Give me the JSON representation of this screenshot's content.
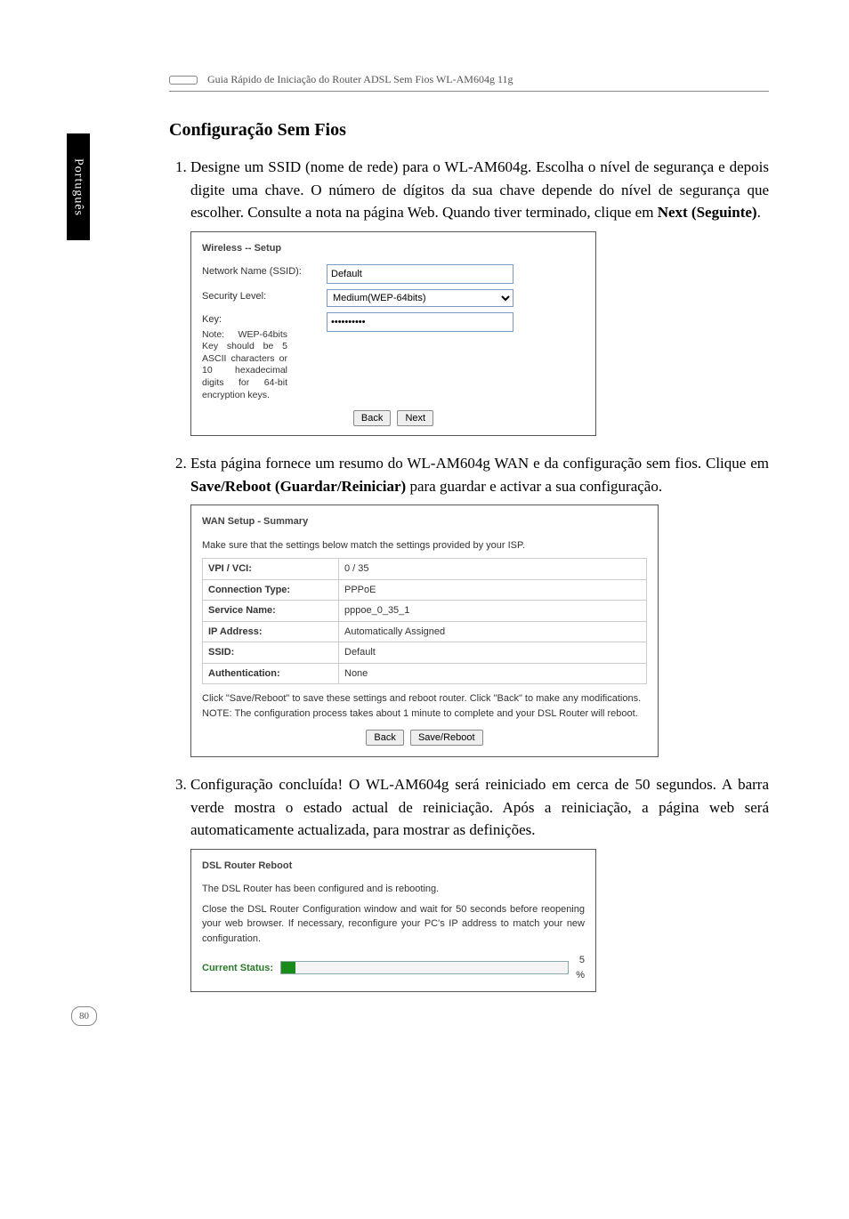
{
  "doc_header": "Guia Rápido de Iniciação do Router ADSL Sem Fios WL-AM604g 11g",
  "side_tab": "Português",
  "section_title": "Configuração Sem Fios",
  "steps": {
    "s1_a": "Designe um SSID (nome de rede) para o WL-AM604g. Escolha o nível de segurança e depois digite uma chave. O número de dígitos da sua chave depende do nível de segurança que escolher. Consulte a nota na página Web. Quando tiver terminado, clique em ",
    "s1_b": "Next (Seguinte)",
    "s1_c": ".",
    "s2_a": "Esta página fornece um resumo do WL-AM604g WAN e da configuração sem fios. Clique em ",
    "s2_b": "Save/Reboot (Guardar/Reiniciar)",
    "s2_c": " para guardar e activar a sua configuração.",
    "s3": "Configuração concluída! O WL-AM604g será reiniciado em cerca de 50 segundos. A barra verde mostra o estado actual de reiniciação. Após a reiniciação, a página web será automaticamente actualizada, para mostrar as definições."
  },
  "wireless": {
    "title": "Wireless -- Setup",
    "ssid_label": "Network Name (SSID):",
    "ssid_value": "Default",
    "sec_label": "Security Level:",
    "sec_value": "Medium(WEP-64bits)",
    "key_label": "Key:",
    "key_value": "••••••••••",
    "note": "Note: WEP-64bits Key should be 5 ASCII characters or 10 hexadecimal digits for 64-bit encryption keys.",
    "btn_back": "Back",
    "btn_next": "Next"
  },
  "wan": {
    "title": "WAN Setup - Summary",
    "intro": "Make sure that the settings below match the settings provided by your ISP.",
    "rows": {
      "vpi_k": "VPI / VCI:",
      "vpi_v": "0 / 35",
      "ct_k": "Connection Type:",
      "ct_v": "PPPoE",
      "sn_k": "Service Name:",
      "sn_v": "pppoe_0_35_1",
      "ip_k": "IP Address:",
      "ip_v": "Automatically Assigned",
      "ssid_k": "SSID:",
      "ssid_v": "Default",
      "auth_k": "Authentication:",
      "auth_v": "None"
    },
    "note": "Click \"Save/Reboot\" to save these settings and reboot router. Click \"Back\" to make any modifications.\nNOTE: The configuration process takes about 1 minute to complete and your DSL Router will reboot.",
    "btn_back": "Back",
    "btn_save": "Save/Reboot"
  },
  "reboot": {
    "title": "DSL Router Reboot",
    "line1": "The DSL Router has been configured and is rebooting.",
    "line2": "Close the DSL Router Configuration window and wait for 50 seconds before reopening your web browser. If necessary, reconfigure your PC's IP address to match your new configuration.",
    "status_label": "Current Status:",
    "pct": "5\n%"
  },
  "pagenum": "80"
}
